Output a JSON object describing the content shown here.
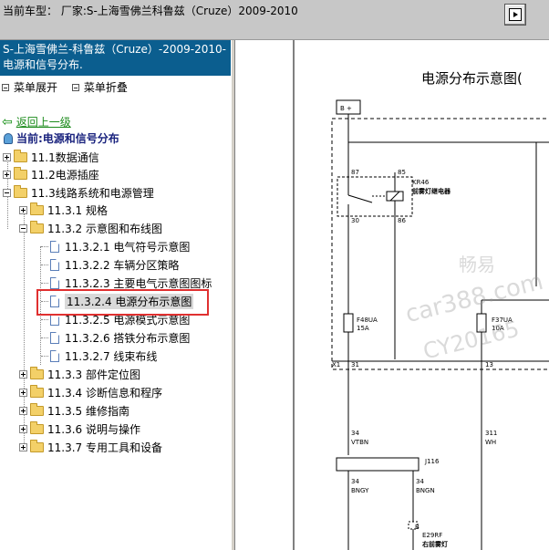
{
  "topbar": {
    "title": "当前车型：  厂家:S-上海雪佛兰科鲁兹（Cruze）2009-2010",
    "nav_button_icon": "forward-icon"
  },
  "left": {
    "header": "S-上海雪佛兰-科鲁兹（Cruze）-2009-2010- 电源和信号分布.",
    "menu": {
      "expand": "菜单展开",
      "collapse": "菜单折叠"
    },
    "back": "返回上一级",
    "current": "当前:电源和信号分布",
    "tree": [
      "11.1数据通信",
      "11.2电源插座",
      "11.3线路系统和电源管理",
      "11.3.1 规格",
      "11.3.2 示意图和布线图",
      "11.3.2.1 电气符号示意图",
      "11.3.2.2 车辆分区策略",
      "11.3.2.3 主要电气示意图图标",
      "11.3.2.4 电源分布示意图",
      "11.3.2.5 电源模式示意图",
      "11.3.2.6 搭铁分布示意图",
      "11.3.2.7 线束布线",
      "11.3.3 部件定位图",
      "11.3.4 诊断信息和程序",
      "11.3.5 维修指南",
      "11.3.6 说明与操作",
      "11.3.7 专用工具和设备"
    ]
  },
  "diagram": {
    "title": "电源分布示意图(",
    "bplus": "B +",
    "relay_id": "KR46",
    "relay_name": "前雾灯继电器",
    "pin87": "87",
    "pin85": "85",
    "pin30": "30",
    "pin86": "86",
    "fuse1_id": "F48UA",
    "fuse1_rating": "15A",
    "fuse2_id": "F37UA",
    "fuse2_rating": "10A",
    "x1": "X1",
    "x1_pin31": "31",
    "x1_pin13": "13",
    "wire1_num": "34",
    "wire1_color": "VTBN",
    "wire2_num": "311",
    "wire2_color": "WH",
    "j116": "J116",
    "j_left_num": "34",
    "j_left_color": "BNGY",
    "j_right_num": "34",
    "j_right_color": "BNGN",
    "conn_b": "B",
    "e29rf": "E29RF",
    "e29rf_name": "右前雾灯",
    "watermark1": "畅易",
    "watermark2": "car388.com",
    "watermark3": "CY20165"
  }
}
